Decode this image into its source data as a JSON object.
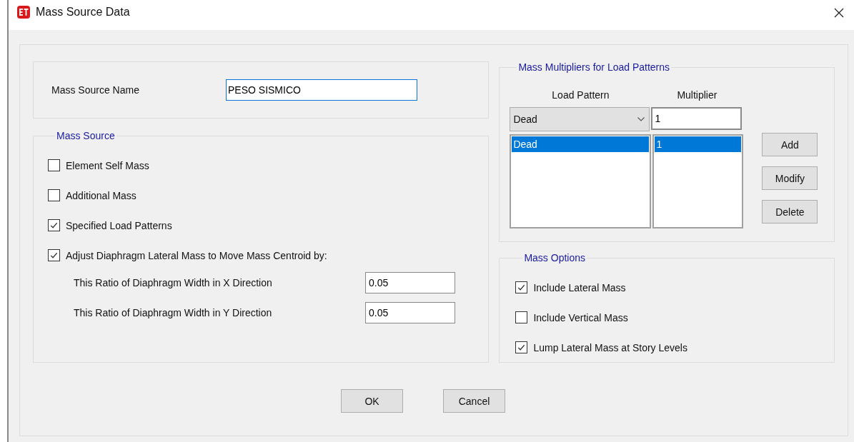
{
  "window": {
    "title": "Mass Source Data"
  },
  "name_field": {
    "label": "Mass Source Name",
    "value": "PESO SISMICO"
  },
  "mass_source": {
    "title": "Mass Source",
    "options": [
      {
        "label": "Element Self Mass",
        "checked": false
      },
      {
        "label": "Additional Mass",
        "checked": false
      },
      {
        "label": "Specified Load Patterns",
        "checked": true
      },
      {
        "label": "Adjust Diaphragm Lateral Mass to Move Mass Centroid by:",
        "checked": true
      }
    ],
    "ratios": [
      {
        "label": "This Ratio of Diaphragm Width in X Direction",
        "value": "0.05"
      },
      {
        "label": "This Ratio of Diaphragm Width in Y Direction",
        "value": "0.05"
      }
    ]
  },
  "multipliers": {
    "title": "Mass Multipliers for Load Patterns",
    "columns": [
      "Load Pattern",
      "Multiplier"
    ],
    "pattern_select": "Dead",
    "multiplier_value": "1",
    "rows": [
      {
        "pattern": "Dead",
        "multiplier": "1",
        "selected": true
      }
    ],
    "buttons": [
      "Add",
      "Modify",
      "Delete"
    ]
  },
  "mass_options": {
    "title": "Mass Options",
    "options": [
      {
        "label": "Include Lateral Mass",
        "checked": true
      },
      {
        "label": "Include Vertical Mass",
        "checked": false
      },
      {
        "label": "Lump Lateral Mass at Story Levels",
        "checked": true
      }
    ]
  },
  "buttons": [
    "OK",
    "Cancel"
  ]
}
